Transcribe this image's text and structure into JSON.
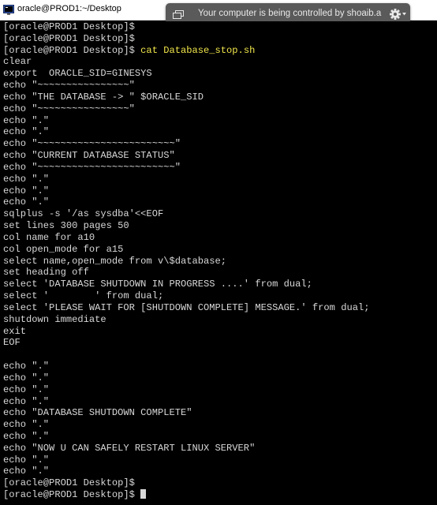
{
  "window": {
    "title": "oracle@PROD1:~/Desktop"
  },
  "remote_banner": {
    "text": "Your computer is being controlled by shoaib.a"
  },
  "terminal": {
    "lines": [
      {
        "prompt": "[oracle@PROD1 Desktop]$",
        "cmd": ""
      },
      {
        "prompt": "[oracle@PROD1 Desktop]$",
        "cmd": ""
      },
      {
        "prompt": "[oracle@PROD1 Desktop]$",
        "cmd": " cat Database_stop.sh"
      },
      {
        "text": "clear"
      },
      {
        "text": "export  ORACLE_SID=GINESYS"
      },
      {
        "text": "echo \"~~~~~~~~~~~~~~~~\""
      },
      {
        "text": "echo \"THE DATABASE -> \" $ORACLE_SID"
      },
      {
        "text": "echo \"~~~~~~~~~~~~~~~~\""
      },
      {
        "text": "echo \".\""
      },
      {
        "text": "echo \".\""
      },
      {
        "text": "echo \"~~~~~~~~~~~~~~~~~~~~~~~~\""
      },
      {
        "text": "echo \"CURRENT DATABASE STATUS\""
      },
      {
        "text": "echo \"~~~~~~~~~~~~~~~~~~~~~~~~\""
      },
      {
        "text": "echo \".\""
      },
      {
        "text": "echo \".\""
      },
      {
        "text": "echo \".\""
      },
      {
        "text": "sqlplus -s '/as sysdba'<<EOF"
      },
      {
        "text": "set lines 300 pages 50"
      },
      {
        "text": "col name for a10"
      },
      {
        "text": "col open_mode for a15"
      },
      {
        "text": "select name,open_mode from v\\$database;"
      },
      {
        "text": "set heading off"
      },
      {
        "text": "select 'DATABASE SHUTDOWN IN PROGRESS ....' from dual;"
      },
      {
        "text": "select '        ' from dual;"
      },
      {
        "text": "select 'PLEASE WAIT FOR [SHUTDOWN COMPLETE] MESSAGE.' from dual;"
      },
      {
        "text": "shutdown immediate"
      },
      {
        "text": "exit"
      },
      {
        "text": "EOF"
      },
      {
        "text": ""
      },
      {
        "text": "echo \".\""
      },
      {
        "text": "echo \".\""
      },
      {
        "text": "echo \".\""
      },
      {
        "text": "echo \".\""
      },
      {
        "text": "echo \"DATABASE SHUTDOWN COMPLETE\""
      },
      {
        "text": "echo \".\""
      },
      {
        "text": "echo \".\""
      },
      {
        "text": "echo \"NOW U CAN SAFELY RESTART LINUX SERVER\""
      },
      {
        "text": "echo \".\""
      },
      {
        "text": "echo \".\""
      },
      {
        "prompt": "[oracle@PROD1 Desktop]$",
        "cmd": ""
      },
      {
        "prompt": "[oracle@PROD1 Desktop]$",
        "cmd": " ",
        "cursor": true
      }
    ]
  },
  "colors": {
    "terminal_bg": "#000000",
    "terminal_fg": "#d8d8d8",
    "command_fg": "#f0e54a",
    "banner_bg": "#5a5a5a"
  }
}
